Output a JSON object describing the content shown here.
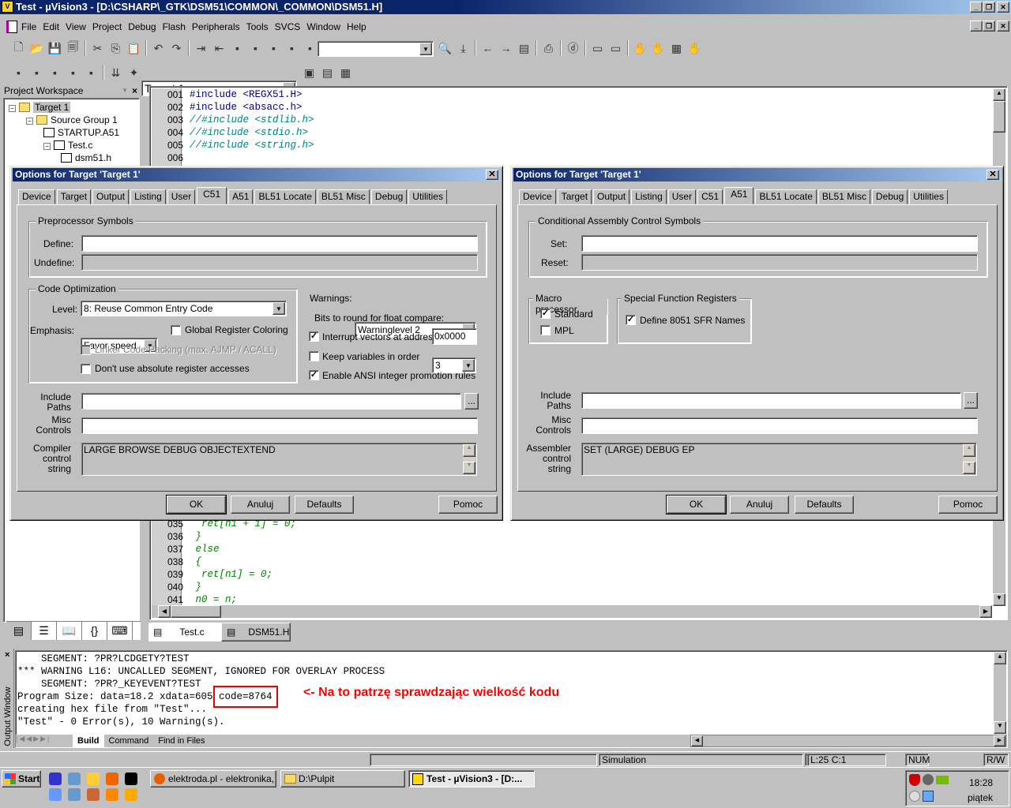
{
  "window": {
    "title": "Test  - µVision3 - [D:\\CSHARP\\_GTK\\DSM51\\COMMON\\_COMMON\\DSM51.H]",
    "controls": [
      "_",
      "❐",
      "✕"
    ]
  },
  "menu": [
    "File",
    "Edit",
    "View",
    "Project",
    "Debug",
    "Flash",
    "Peripherals",
    "Tools",
    "SVCS",
    "Window",
    "Help"
  ],
  "toolbar1": [
    "new-file-icon",
    "open-icon",
    "save-icon",
    "save-all-icon",
    "|",
    "cut-icon",
    "copy-icon",
    "paste-icon",
    "|",
    "undo-icon",
    "redo-icon",
    "|",
    "indent-icon",
    "outdent-icon",
    "bookmark-icon",
    "next-bookmark-icon",
    "prev-bookmark-icon",
    "clear-bookmarks-icon",
    "find-in-files-icon"
  ],
  "toolbar1b": [
    "find-icon",
    "find-next-icon",
    "|",
    "back-icon",
    "forward-icon",
    "browse-icon",
    "|",
    "print-icon",
    "|",
    "debug-icon",
    "|",
    "workspace-icon",
    "output-icon",
    "|",
    "hand-icon",
    "hand2-icon",
    "hand3-icon",
    "hand4-icon"
  ],
  "toolbar2": [
    "translate-icon",
    "build-icon",
    "rebuild-icon",
    "batch-build-icon",
    "stop-build-icon",
    "|",
    "load-icon",
    "options-wand-icon"
  ],
  "toolbar2b": [
    "components-icon",
    "multi-project-icon",
    "manage-icon"
  ],
  "target_select": "Target 1",
  "find_combo": "",
  "workspace": {
    "title": "Project Workspace",
    "tree": [
      {
        "label": "Target 1",
        "level": 0
      },
      {
        "label": "Source Group 1",
        "level": 1
      },
      {
        "label": "STARTUP.A51",
        "level": 2
      },
      {
        "label": "Test.c",
        "level": 2
      },
      {
        "label": "dsm51.h",
        "level": 3
      }
    ],
    "tabs": [
      "files-icon",
      "regs-icon",
      "books-icon",
      "functions-icon",
      "templates-icon"
    ]
  },
  "editor": {
    "top": [
      {
        "n": "001",
        "t": "#include <REGX51.H>",
        "k": "inc"
      },
      {
        "n": "002",
        "t": "#include <absacc.h>",
        "k": "inc"
      },
      {
        "n": "003",
        "t": "//#include <stdlib.h>",
        "k": "cmt"
      },
      {
        "n": "004",
        "t": "//#include <stdio.h>",
        "k": "cmt"
      },
      {
        "n": "005",
        "t": "//#include <string.h>",
        "k": "cmt"
      },
      {
        "n": "006",
        "t": "",
        "k": "inc"
      }
    ],
    "bottom": [
      {
        "n": "035",
        "t": "  ret[n1 + 1] = 0;"
      },
      {
        "n": "036",
        "t": " }"
      },
      {
        "n": "037",
        "t": " else"
      },
      {
        "n": "038",
        "t": " {"
      },
      {
        "n": "039",
        "t": "  ret[n1] = 0;"
      },
      {
        "n": "040",
        "t": " }"
      },
      {
        "n": "041",
        "t": " n0 = n;"
      }
    ],
    "tabs": [
      "Test.c",
      "DSM51.H"
    ]
  },
  "dialog1": {
    "title": "Options for Target 'Target 1'",
    "tabs": [
      "Device",
      "Target",
      "Output",
      "Listing",
      "User",
      "C51",
      "A51",
      "BL51 Locate",
      "BL51 Misc",
      "Debug",
      "Utilities"
    ],
    "active": "C51",
    "pre_group": "Preprocessor Symbols",
    "define_label": "Define:",
    "define_value": "",
    "undefine_label": "Undefine:",
    "opt_group": "Code Optimization",
    "level_label": "Level:",
    "level_value": "8: Reuse Common Entry Code",
    "emphasis_label": "Emphasis:",
    "emphasis_value": "Favor speed",
    "global_reg": "Global Register Coloring",
    "global_reg_checked": false,
    "linker_packing": "Linker Code Packing (max. AJMP / ACALL)",
    "no_abs_reg": "Don't use absolute register accesses",
    "no_abs_checked": false,
    "warnings_label": "Warnings:",
    "warnings_value": "Warninglevel 2",
    "bits_label": "Bits to round for float compare:",
    "bits_value": "3",
    "intvec_label": "Interrupt vectors at address:",
    "intvec_checked": true,
    "intvec_value": "0x0000",
    "keep_vars": "Keep variables in order",
    "keep_checked": false,
    "ansi": "Enable ANSI integer promotion rules",
    "ansi_checked": true,
    "include_label1": "Include",
    "include_label2": "Paths",
    "misc_label1": "Misc",
    "misc_label2": "Controls",
    "cc_label1": "Compiler",
    "cc_label2": "control",
    "cc_label3": "string",
    "cc_value": "LARGE BROWSE DEBUG OBJECTEXTEND",
    "browse": "...",
    "ok": "OK",
    "cancel": "Anuluj",
    "defaults": "Defaults",
    "help": "Pomoc"
  },
  "dialog2": {
    "title": "Options for Target 'Target 1'",
    "tabs": [
      "Device",
      "Target",
      "Output",
      "Listing",
      "User",
      "C51",
      "A51",
      "BL51 Locate",
      "BL51 Misc",
      "Debug",
      "Utilities"
    ],
    "active": "A51",
    "cond_group": "Conditional Assembly Control Symbols",
    "set_label": "Set:",
    "set_value": "",
    "reset_label": "Reset:",
    "macro_group": "Macro processor",
    "standard": "Standard",
    "standard_checked": true,
    "mpl": "MPL",
    "mpl_checked": false,
    "sfr_group": "Special Function Registers",
    "sfr": "Define 8051 SFR Names",
    "sfr_checked": true,
    "include_label1": "Include",
    "include_label2": "Paths",
    "misc_label1": "Misc",
    "misc_label2": "Controls",
    "ac_label1": "Assembler",
    "ac_label2": "control",
    "ac_label3": "string",
    "ac_value": "SET (LARGE) DEBUG EP",
    "browse": "...",
    "ok": "OK",
    "cancel": "Anuluj",
    "defaults": "Defaults",
    "help": "Pomoc"
  },
  "output": {
    "side_label": "Output Window",
    "lines": [
      "    SEGMENT: ?PR?LCDGETY?TEST",
      "*** WARNING L16: UNCALLED SEGMENT, IGNORED FOR OVERLAY PROCESS",
      "    SEGMENT: ?PR?_KEYEVENT?TEST",
      "Program Size: data=18.2 xdata=605 ",
      "creating hex file from \"Test\"...",
      "\"Test\" - 0 Error(s), 10 Warning(s)."
    ],
    "highlight": "code=8764",
    "annotation": "<- Na to patrzę sprawdzając wielkość kodu",
    "annotation_color": "#ff0000",
    "tabs": [
      "Build",
      "Command",
      "Find in Files"
    ]
  },
  "status": {
    "mode": "Simulation",
    "position": "L:25 C:1",
    "num": "NUM",
    "rw": "R/W"
  },
  "taskbar": {
    "start": "Start",
    "quick_launch": [
      "save-icon",
      "phone-icon",
      "folder-icon",
      "firefox-icon",
      "cmd-icon",
      "doc-icon",
      "calc-icon",
      "paint-icon",
      "vlc-icon",
      "winamp-icon"
    ],
    "tasks": [
      "elektroda.pl - elektronika, ...",
      "D:\\Pulpit",
      "Test  - µVision3 - [D:..."
    ],
    "time": "18:28",
    "day": "piątek"
  }
}
